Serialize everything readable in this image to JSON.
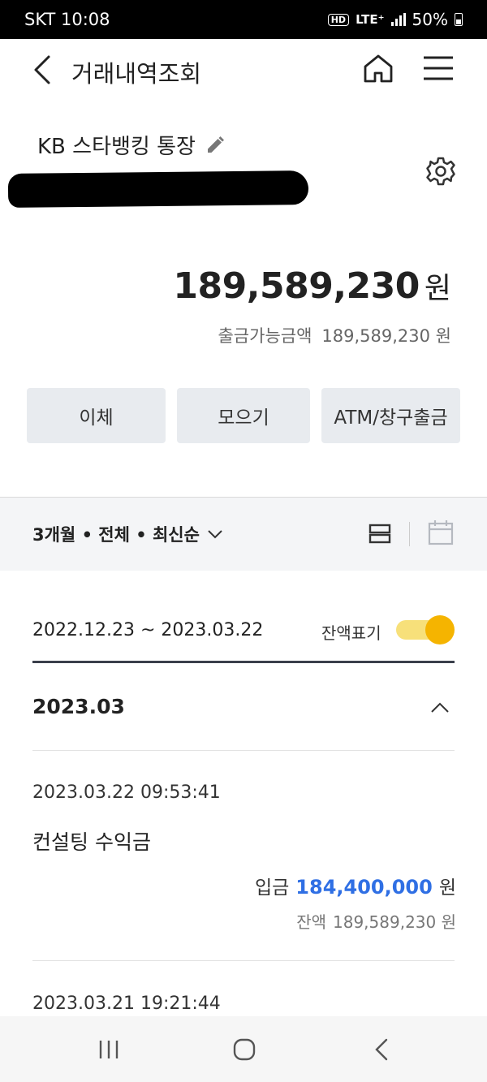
{
  "status_bar": {
    "carrier_time": "SKT 10:08",
    "hd": "HD",
    "network": "LTE⁺",
    "battery": "50%"
  },
  "header": {
    "title": "거래내역조회",
    "icons": {
      "back": "chevron-left-icon",
      "home": "home-icon",
      "menu": "hamburger-menu-icon"
    }
  },
  "account": {
    "name": "KB 스타뱅킹 통장",
    "balance_amount": "189,589,230",
    "balance_unit": "원",
    "available_label": "출금가능금액",
    "available_amount": "189,589,230 원"
  },
  "actions": [
    {
      "label": "이체"
    },
    {
      "label": "모으기"
    },
    {
      "label": "ATM/창구출금"
    }
  ],
  "filter": {
    "summary": "3개월 • 전체 • 최신순"
  },
  "range": {
    "dates": "2022.12.23 ~ 2023.03.22",
    "toggle_label": "잔액표기",
    "toggle_on": true
  },
  "colors": {
    "accent_yellow": "#f5b400",
    "deposit_blue": "#2f6fe4"
  },
  "month": {
    "label": "2023.03"
  },
  "transactions": [
    {
      "datetime": "2023.03.22 09:53:41",
      "description": "컨설팅 수익금",
      "type": "입금",
      "amount": "184,400,000",
      "unit": "원",
      "balance_label": "잔액",
      "balance": "189,589,230 원"
    },
    {
      "datetime": "2023.03.21 19:21:44"
    }
  ]
}
